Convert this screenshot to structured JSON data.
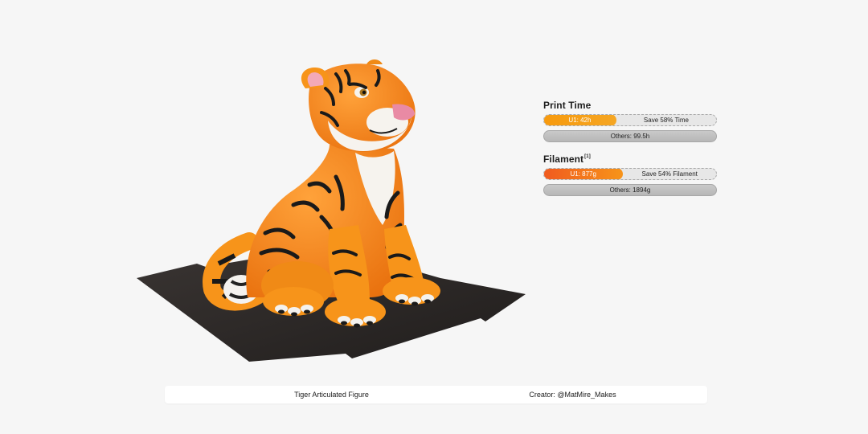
{
  "colors": {
    "background": "#f6f6f6",
    "accent_time": "#f79a0e",
    "accent_filament": "#f05a1e",
    "others_bar": "#bdbdbd"
  },
  "hero": {
    "icon": "tiger-figure-on-build-plate-image"
  },
  "print_time": {
    "title": "Print Time",
    "u1_label": "U1: 42h",
    "u1_fraction": 0.42,
    "save_label": "Save 58% Time",
    "others_label": "Others: 99.5h"
  },
  "filament": {
    "title": "Filament",
    "footnote": "[1]",
    "u1_label": "U1: 877g",
    "u1_fraction": 0.46,
    "save_label": "Save 54% Filament",
    "others_label": "Others: 1894g"
  },
  "caption": {
    "model_name": "Tiger Articulated Figure",
    "creator": "Creator: @MatMire_Makes"
  }
}
